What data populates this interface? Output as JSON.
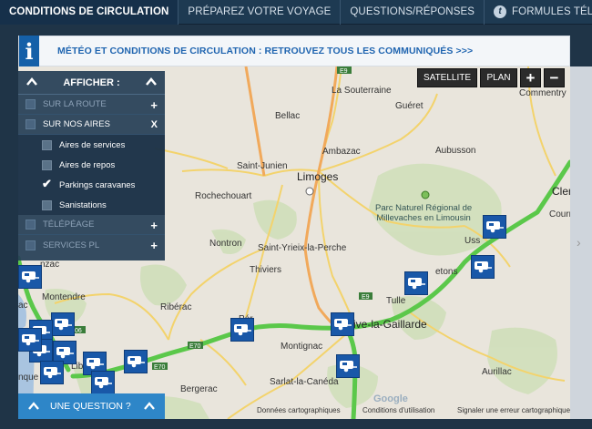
{
  "nav": {
    "tabs": [
      {
        "label": "CONDITIONS DE CIRCULATION",
        "active": true
      },
      {
        "label": "PRÉPAREZ VOTRE VOYAGE"
      },
      {
        "label": "QUESTIONS/RÉPONSES"
      },
      {
        "label": "FORMULES TÉLÉPAGE",
        "icon": "telepeage-icon"
      }
    ]
  },
  "banner": {
    "icon": "info-icon",
    "message": "MÉTÉO ET CONDITIONS DE CIRCULATION : RETROUVEZ TOUS LES COMMUNIQUÉS >>>"
  },
  "map_controls": {
    "satellite": "SATELLITE",
    "plan": "PLAN",
    "zoom_in": "+",
    "zoom_out": "−"
  },
  "filter_panel": {
    "title": "AFFICHER :",
    "sections": [
      {
        "label": "SUR LA ROUTE",
        "toggle": "+",
        "dim": true
      },
      {
        "label": "SUR NOS AIRES",
        "toggle": "X",
        "dim": false,
        "items": [
          {
            "label": "Aires de services",
            "checked": false
          },
          {
            "label": "Aires de repos",
            "checked": false
          },
          {
            "label": "Parkings caravanes",
            "checked": true
          },
          {
            "label": "Sanistations",
            "checked": false
          }
        ]
      },
      {
        "label": "TÉLÉPÉAGE",
        "toggle": "+",
        "dim": true
      },
      {
        "label": "SERVICES PL",
        "toggle": "+",
        "dim": true
      }
    ]
  },
  "question_bar": {
    "label": "UNE QUESTION ?"
  },
  "places": {
    "la_souterraine": "La Souterraine",
    "bellac": "Bellac",
    "gueret": "Guéret",
    "commentry": "Commentry",
    "ambazac": "Ambazac",
    "saint_junien": "Saint-Junien",
    "limoges": "Limoges",
    "aubusson": "Aubusson",
    "rochechouart": "Rochechouart",
    "parc": "Parc Naturel Régional de",
    "parc2": "Millevaches en Limousin",
    "nontron": "Nontron",
    "saint_yrieix": "Saint-Yrieix-la-Perche",
    "ussel": "Uss",
    "thiviers": "Thiviers",
    "tulle": "Tulle",
    "montendre": "Montendre",
    "riberac": "Ribérac",
    "brive": "Brive-la-Gaillarde",
    "montignac": "Montignac",
    "sarlat": "Sarlat-la-Canéda",
    "aurillac": "Aurillac",
    "bergerac": "Bergerac",
    "clermont": "Clermo",
    "cournon": "Courn",
    "jonzac": "nzac",
    "libourne": "Lib",
    "perigueux": "Pér",
    "egletons": "etons",
    "ac": "ac",
    "nque": "nque"
  },
  "road_labels": {
    "e9": "E9",
    "e70": "E70",
    "e9b": "E9",
    "e70b": "E70",
    "06": "06"
  },
  "credits": {
    "data": "Données cartographiques",
    "terms": "Conditions d'utilisation",
    "report": "Signaler une erreur cartographique"
  },
  "google": "Google",
  "colors": {
    "nav_bg": "#1e3a52",
    "accent_blue": "#2e86c8",
    "caravan_blue": "#1958a8",
    "highway_green": "#5bc84a"
  }
}
